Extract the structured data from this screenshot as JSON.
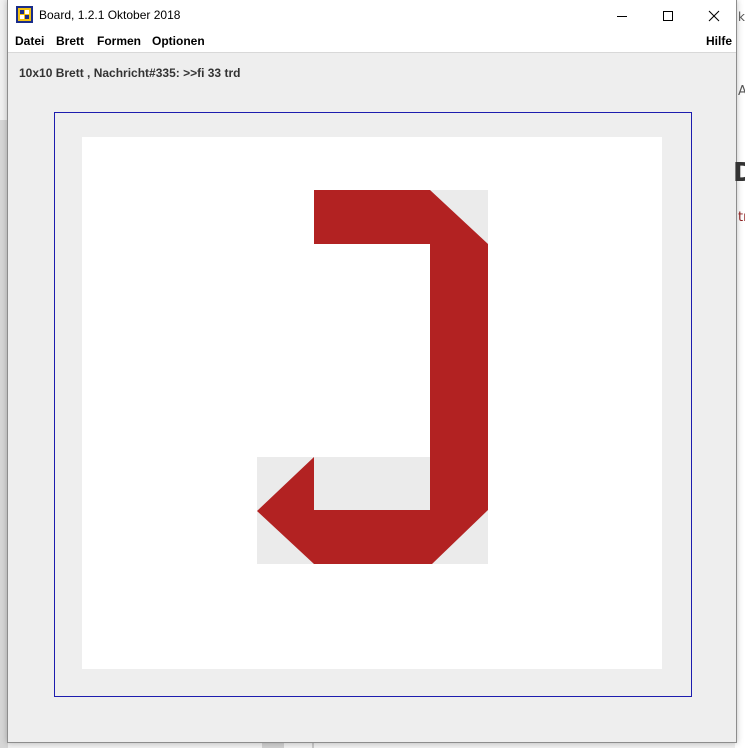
{
  "window": {
    "title": "Board, 1.2.1 Oktober 2018",
    "icon": "board-app-icon"
  },
  "menu": {
    "items": [
      "Datei",
      "Brett",
      "Formen",
      "Optionen"
    ],
    "help": "Hilfe"
  },
  "status": {
    "text": "10x10 Brett , Nachricht#335: >>fi 33 trd"
  },
  "board": {
    "size": "10x10",
    "colors": {
      "frame": "#1c1cae",
      "canvas": "#ffffff",
      "cell_fill": "#ebebeb",
      "shape": "#b22222"
    }
  },
  "controls": {
    "minimize": "minimize-icon",
    "maximize": "maximize-icon",
    "close": "close-icon"
  }
}
